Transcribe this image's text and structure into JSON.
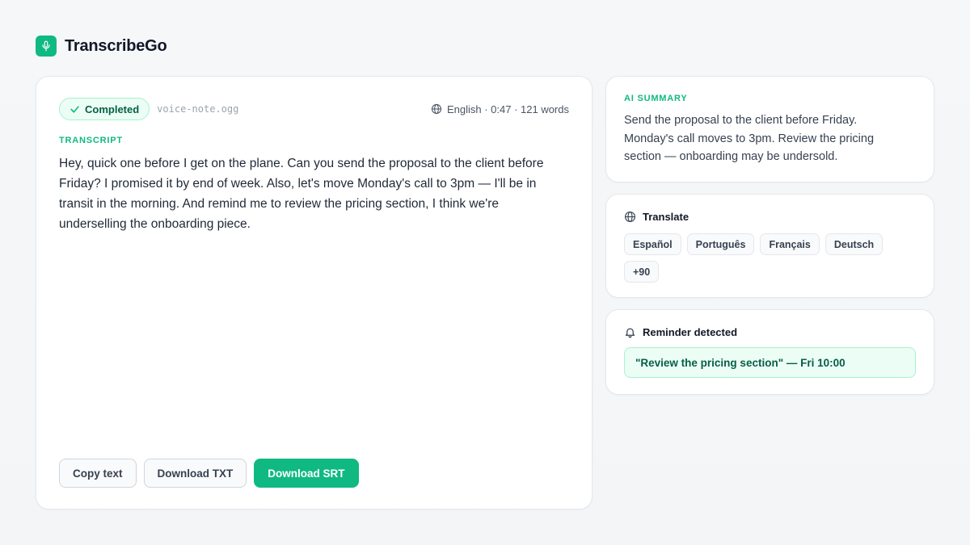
{
  "app": {
    "name": "TranscribeGo",
    "logo_icon": "microphone-icon",
    "accent_color": "#10b981"
  },
  "main": {
    "status": {
      "label": "Completed",
      "icon": "check-icon"
    },
    "filename": "voice-note.ogg",
    "meta": {
      "icon": "globe-icon",
      "text": "English · 0:47 · 121 words"
    },
    "transcript_label": "Transcript",
    "transcript_text": "Hey, quick one before I get on the plane. Can you send the proposal to the client before Friday? I promised it by end of week. Also, let's move Monday's call to 3pm — I'll be in transit in the morning. And remind me to review the pricing section, I think we're underselling the onboarding piece.",
    "actions": {
      "copy_label": "Copy text",
      "download_txt_label": "Download TXT",
      "download_srt_label": "Download SRT"
    }
  },
  "summary": {
    "label": "AI Summary",
    "text": "Send the proposal to the client before Friday. Monday's call moves to 3pm. Review the pricing section — onboarding may be undersold."
  },
  "translate": {
    "title": "Translate",
    "icon": "globe-icon",
    "languages": [
      "Español",
      "Português",
      "Français",
      "Deutsch",
      "+90"
    ]
  },
  "reminder": {
    "title": "Reminder detected",
    "icon": "bell-icon",
    "text": "\"Review the pricing section\" — Fri 10:00"
  }
}
